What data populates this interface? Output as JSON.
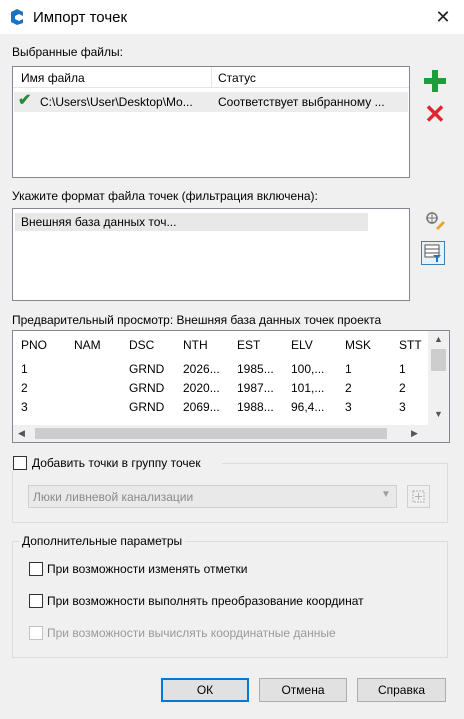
{
  "window": {
    "title": "Импорт точек",
    "close_glyph": "✕"
  },
  "selected_files": {
    "label": "Выбранные файлы:",
    "columns": [
      "Имя файла",
      "Статус"
    ],
    "rows": [
      {
        "filename": "C:\\Users\\User\\Desktop\\Mo...",
        "status": "Соответствует выбранному ..."
      }
    ]
  },
  "format": {
    "label": "Укажите формат файла точек (фильтрация включена):",
    "items": [
      "Внешняя база данных точ..."
    ]
  },
  "preview": {
    "label": "Предварительный просмотр: Внешняя база данных точек проекта",
    "columns": [
      "PNO",
      "NAM",
      "DSC",
      "NTH",
      "EST",
      "ELV",
      "MSK",
      "STT"
    ],
    "rows": [
      [
        "1",
        "",
        "GRND",
        "2026...",
        "1985...",
        "100,...",
        "1",
        "1"
      ],
      [
        "2",
        "",
        "GRND",
        "2020...",
        "1987...",
        "101,...",
        "2",
        "2"
      ],
      [
        "3",
        "",
        "GRND",
        "2069...",
        "1988...",
        "96,4...",
        "3",
        "3"
      ]
    ]
  },
  "group": {
    "checkbox_label": "Добавить точки в группу точек",
    "combo_value": "Люки ливневой канализации"
  },
  "advanced": {
    "label": "Дополнительные параметры",
    "options": [
      "При возможности изменять отметки",
      "При возможности выполнять преобразование координат",
      "При возможности вычислять координатные данные"
    ]
  },
  "buttons": {
    "ok": "ОК",
    "cancel": "Отмена",
    "help": "Справка"
  },
  "colors": {
    "accent": "#0078d7",
    "add_green": "#1f9d3a",
    "remove_red": "#e0262e"
  },
  "icons": [
    "civil3d-app-icon",
    "close-icon",
    "check-icon",
    "add-icon",
    "remove-icon",
    "edit-format-icon",
    "filter-format-icon",
    "pick-icon"
  ]
}
